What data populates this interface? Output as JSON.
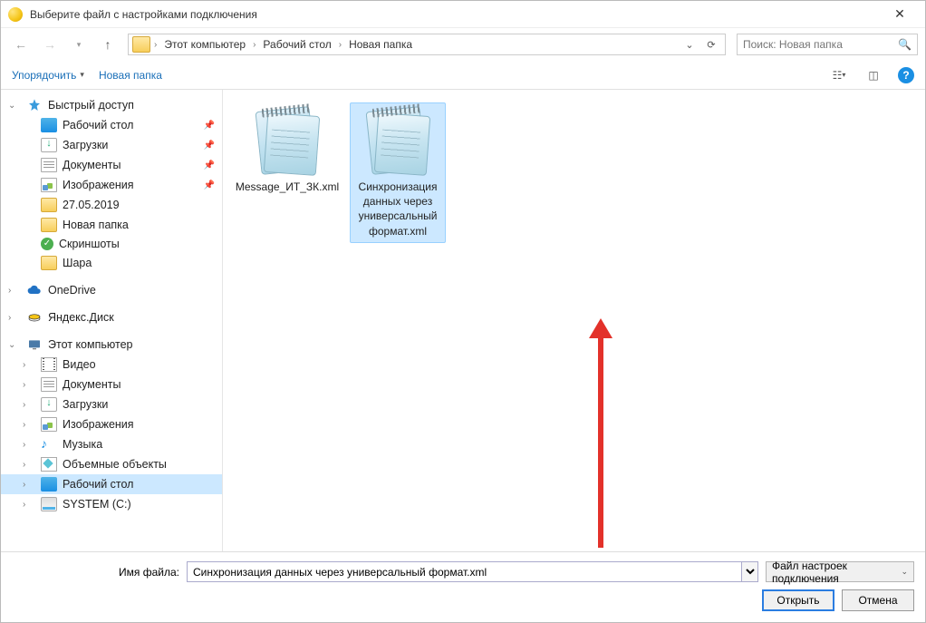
{
  "window": {
    "title": "Выберите файл с настройками подключения"
  },
  "breadcrumbs": {
    "root": "Этот компьютер",
    "p1": "Рабочий стол",
    "p2": "Новая папка"
  },
  "search": {
    "placeholder": "Поиск: Новая папка"
  },
  "toolbar": {
    "organize": "Упорядочить",
    "newfolder": "Новая папка"
  },
  "tree": {
    "quick": "Быстрый доступ",
    "desktop": "Рабочий стол",
    "downloads": "Загрузки",
    "documents": "Документы",
    "images": "Изображения",
    "date": "27.05.2019",
    "newfolder": "Новая папка",
    "screenshots": "Скриншоты",
    "share": "Шара",
    "onedrive": "OneDrive",
    "yadisk": "Яндекс.Диск",
    "thispc": "Этот компьютер",
    "video": "Видео",
    "documents2": "Документы",
    "downloads2": "Загрузки",
    "images2": "Изображения",
    "music": "Музыка",
    "objects": "Объемные объекты",
    "desktop2": "Рабочий стол",
    "sysc": "SYSTEM (C:)"
  },
  "files": {
    "f1": "Message_ИТ_ЗК.xml",
    "f2": "Синхронизация данных через универсальный формат.xml"
  },
  "footer": {
    "fn_label": "Имя файла:",
    "fn_value": "Синхронизация данных через универсальный формат.xml",
    "filter": "Файл настроек подключения",
    "open": "Открыть",
    "cancel": "Отмена"
  }
}
